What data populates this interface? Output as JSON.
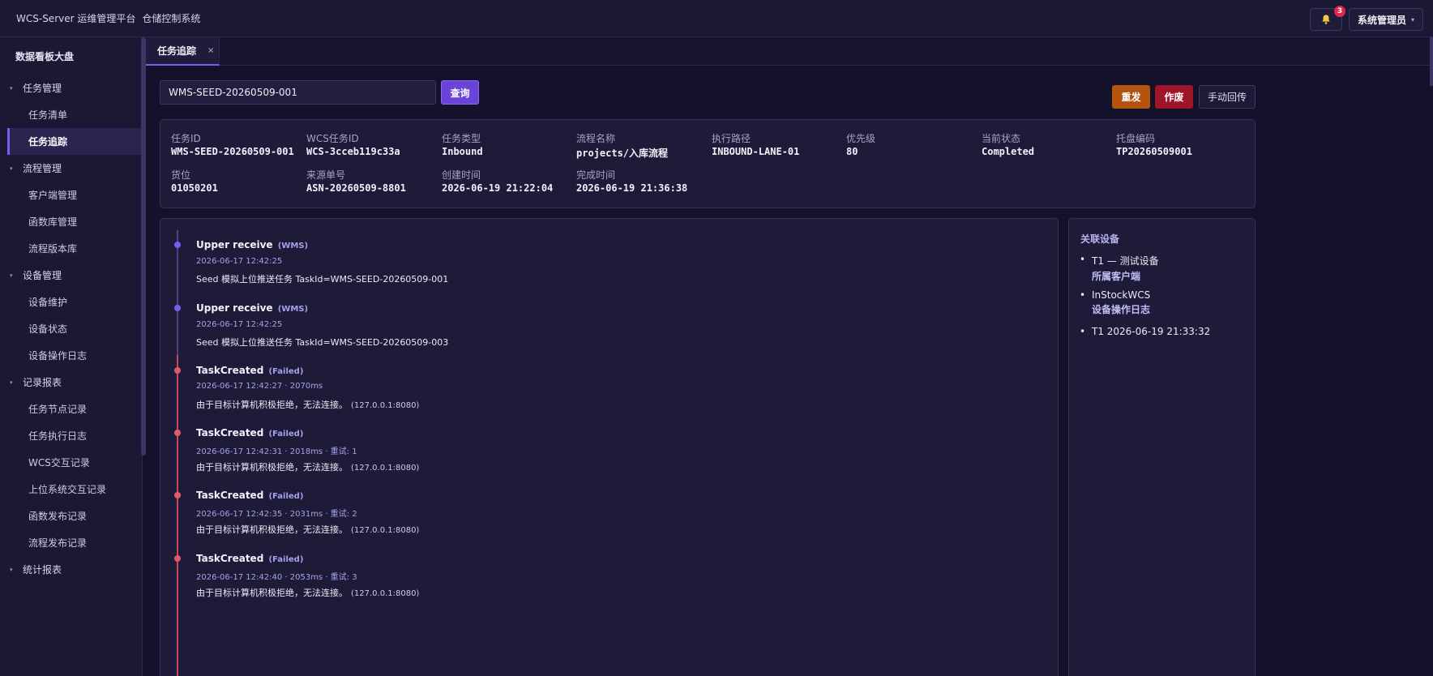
{
  "header": {
    "app_title": "WCS-Server 运维管理平台",
    "subtitle": "仓储控制系统",
    "notification_count": "3",
    "user_name": "系统管理员"
  },
  "sidebar": {
    "title": "数据看板大盘",
    "groups": [
      {
        "label": "任务管理",
        "items": [
          "任务清单",
          "任务追踪"
        ]
      },
      {
        "label": "流程管理",
        "items": [
          "客户端管理",
          "函数库管理",
          "流程版本库"
        ]
      },
      {
        "label": "设备管理",
        "items": [
          "设备维护",
          "设备状态",
          "设备操作日志"
        ]
      },
      {
        "label": "记录报表",
        "items": [
          "任务节点记录",
          "任务执行日志",
          "WCS交互记录",
          "上位系统交互记录",
          "函数发布记录",
          "流程发布记录"
        ]
      },
      {
        "label": "统计报表",
        "items": []
      }
    ],
    "active_item": "任务追踪"
  },
  "tabs": [
    {
      "label": "任务追踪",
      "close": "×"
    }
  ],
  "search": {
    "value": "WMS-SEED-20260509-001",
    "button": "查询"
  },
  "actions": {
    "resend": "重发",
    "void": "作废",
    "manual_callback": "手动回传"
  },
  "task_info": [
    {
      "label": "任务ID",
      "value": "WMS-SEED-20260509-001"
    },
    {
      "label": "WCS任务ID",
      "value": "WCS-3cceb119c33a"
    },
    {
      "label": "任务类型",
      "value": "Inbound"
    },
    {
      "label": "流程名称",
      "value": "projects/入库流程"
    },
    {
      "label": "执行路径",
      "value": "INBOUND-LANE-01"
    },
    {
      "label": "优先级",
      "value": "80"
    },
    {
      "label": "当前状态",
      "value": "Completed"
    },
    {
      "label": "托盘编码",
      "value": "TP20260509001"
    },
    {
      "label": "货位",
      "value": "01050201"
    },
    {
      "label": "来源单号",
      "value": "ASN-20260509-8801"
    },
    {
      "label": "创建时间",
      "value": "2026-06-19 21:22:04"
    },
    {
      "label": "完成时间",
      "value": "2026-06-19 21:36:38"
    }
  ],
  "timeline": [
    {
      "title": "Upper receive",
      "tag": "(WMS)",
      "time": "2026-06-17 12:42:25",
      "message": "Seed 模拟上位推送任务 TaskId=WMS-SEED-20260509-001",
      "host": "",
      "status": "ok"
    },
    {
      "title": "Upper receive",
      "tag": "(WMS)",
      "time": "2026-06-17 12:42:25",
      "message": "Seed 模拟上位推送任务 TaskId=WMS-SEED-20260509-003",
      "host": "",
      "status": "ok"
    },
    {
      "title": "TaskCreated",
      "tag": "(Failed)",
      "time": "2026-06-17 12:42:27 · 2070ms",
      "message": "由于目标计算机积极拒绝，无法连接。",
      "host": "(127.0.0.1:8080)",
      "status": "failed"
    },
    {
      "title": "TaskCreated",
      "tag": "(Failed)",
      "time": "2026-06-17 12:42:31 · 2018ms · 重试: 1",
      "message": "由于目标计算机积极拒绝，无法连接。",
      "host": "(127.0.0.1:8080)",
      "status": "failed"
    },
    {
      "title": "TaskCreated",
      "tag": "(Failed)",
      "time": "2026-06-17 12:42:35 · 2031ms · 重试: 2",
      "message": "由于目标计算机积极拒绝，无法连接。",
      "host": "(127.0.0.1:8080)",
      "status": "failed"
    },
    {
      "title": "TaskCreated",
      "tag": "(Failed)",
      "time": "2026-06-17 12:42:40 · 2053ms · 重试: 3",
      "message": "由于目标计算机积极拒绝，无法连接。",
      "host": "(127.0.0.1:8080)",
      "status": "failed"
    }
  ],
  "devices": {
    "title": "关联设备",
    "items": [
      {
        "line1": "T1 — 测试设备",
        "line2": "所属客户端"
      },
      {
        "line1": "InStockWCS",
        "line2": "设备操作日志"
      },
      {
        "line1": "T1 2026-06-19 21:33:32",
        "line2": ""
      }
    ]
  },
  "colors": {
    "accent": "#6a44d6",
    "resend": "#b4540f",
    "void": "#a0142a",
    "failed_dot": "#e05a6e",
    "ok_dot": "#7b5cf0"
  }
}
